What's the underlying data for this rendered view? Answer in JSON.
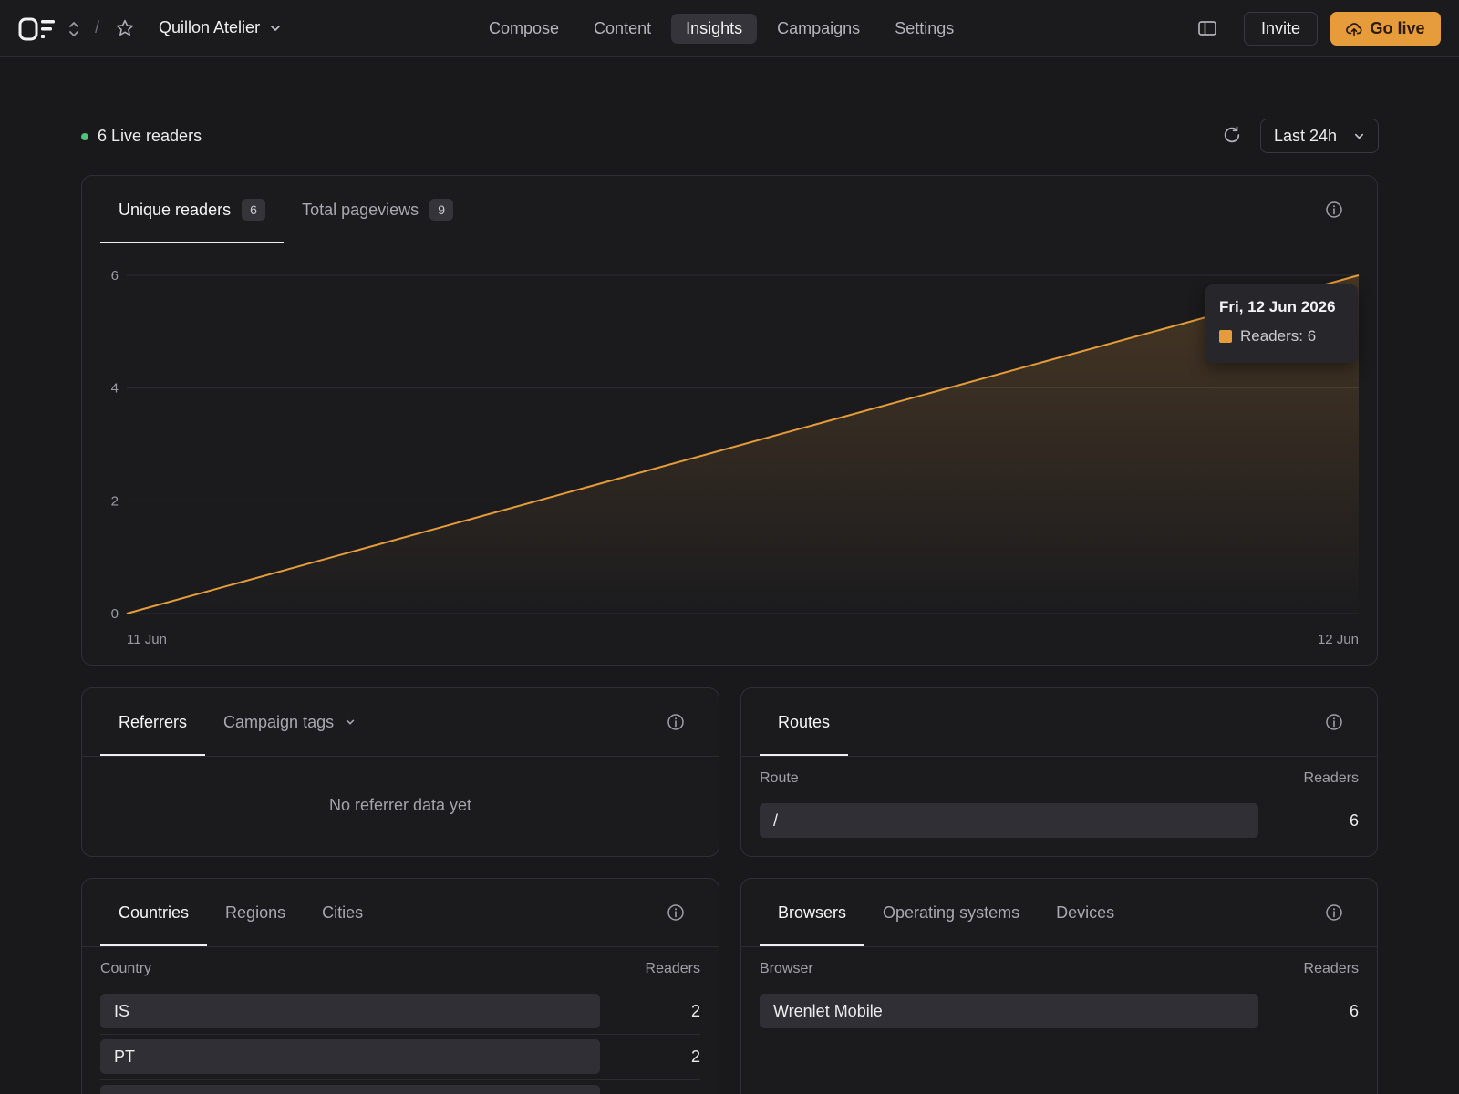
{
  "header": {
    "org_name": "Quillon Atelier",
    "separator": "/",
    "nav": [
      {
        "label": "Compose",
        "active": false
      },
      {
        "label": "Content",
        "active": false
      },
      {
        "label": "Insights",
        "active": true
      },
      {
        "label": "Campaigns",
        "active": false
      },
      {
        "label": "Settings",
        "active": false
      }
    ],
    "invite_label": "Invite",
    "golive_label": "Go live"
  },
  "live": {
    "label": "6 Live readers"
  },
  "range": {
    "label": "Last 24h"
  },
  "main_chart": {
    "tabs": [
      {
        "label": "Unique readers",
        "badge": "6",
        "active": true
      },
      {
        "label": "Total pageviews",
        "badge": "9",
        "active": false
      }
    ],
    "tooltip": {
      "title": "Fri, 12 Jun 2026",
      "series_label": "Readers: 6"
    }
  },
  "chart_data": {
    "type": "area",
    "x": [
      "11 Jun",
      "12 Jun"
    ],
    "series": [
      {
        "name": "Readers",
        "values": [
          0,
          6
        ]
      }
    ],
    "yticks": [
      0,
      2,
      4,
      6
    ],
    "xtick_labels": [
      "11 Jun",
      "12 Jun"
    ],
    "ylim": [
      0,
      6
    ],
    "grid": true,
    "color": "#e69c3a"
  },
  "referrers": {
    "tabs": [
      {
        "label": "Referrers",
        "active": true
      },
      {
        "label": "Campaign tags",
        "active": false
      }
    ],
    "empty_message": "No referrer data yet"
  },
  "routes": {
    "tabs": [
      {
        "label": "Routes",
        "active": true
      }
    ],
    "col_left": "Route",
    "col_right": "Readers",
    "rows": [
      {
        "label": "/",
        "value": "6",
        "fraction": 1.0
      }
    ]
  },
  "geo": {
    "tabs": [
      {
        "label": "Countries",
        "active": true
      },
      {
        "label": "Regions",
        "active": false
      },
      {
        "label": "Cities",
        "active": false
      }
    ],
    "col_left": "Country",
    "col_right": "Readers",
    "rows": [
      {
        "label": "IS",
        "value": "2",
        "fraction": 1.0
      },
      {
        "label": "PT",
        "value": "2",
        "fraction": 1.0
      }
    ]
  },
  "tech": {
    "tabs": [
      {
        "label": "Browsers",
        "active": true
      },
      {
        "label": "Operating systems",
        "active": false
      },
      {
        "label": "Devices",
        "active": false
      }
    ],
    "col_left": "Browser",
    "col_right": "Readers",
    "rows": [
      {
        "label": "Wrenlet Mobile",
        "value": "6",
        "fraction": 1.0
      }
    ]
  }
}
